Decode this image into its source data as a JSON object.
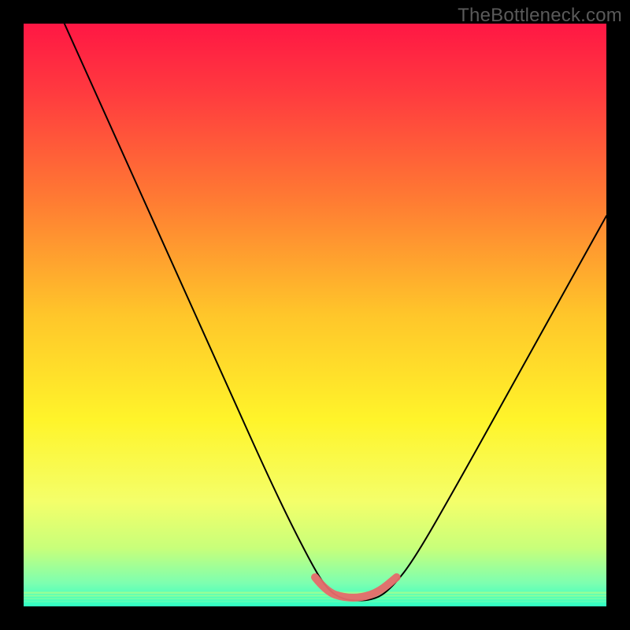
{
  "watermark": "TheBottleneck.com",
  "chart_data": {
    "type": "line",
    "title": "",
    "xlabel": "",
    "ylabel": "",
    "xlim": [
      0,
      100
    ],
    "ylim": [
      0,
      100
    ],
    "grid": false,
    "background": {
      "type": "vertical-gradient",
      "stops": [
        {
          "offset": 0.0,
          "color": "#ff1744"
        },
        {
          "offset": 0.12,
          "color": "#ff3b3f"
        },
        {
          "offset": 0.3,
          "color": "#ff7a33"
        },
        {
          "offset": 0.5,
          "color": "#ffc62a"
        },
        {
          "offset": 0.68,
          "color": "#fff42a"
        },
        {
          "offset": 0.82,
          "color": "#f4ff6a"
        },
        {
          "offset": 0.9,
          "color": "#c8ff7a"
        },
        {
          "offset": 0.96,
          "color": "#7dffb0"
        },
        {
          "offset": 1.0,
          "color": "#2affc4"
        }
      ]
    },
    "series": [
      {
        "name": "bottleneck-curve",
        "color": "#000000",
        "width": 2,
        "points": [
          {
            "x": 7,
            "y": 100
          },
          {
            "x": 16,
            "y": 80
          },
          {
            "x": 25,
            "y": 60
          },
          {
            "x": 34,
            "y": 40
          },
          {
            "x": 43,
            "y": 20
          },
          {
            "x": 49,
            "y": 8
          },
          {
            "x": 52,
            "y": 3
          },
          {
            "x": 55,
            "y": 1
          },
          {
            "x": 60,
            "y": 1
          },
          {
            "x": 63,
            "y": 3
          },
          {
            "x": 67,
            "y": 8
          },
          {
            "x": 75,
            "y": 22
          },
          {
            "x": 85,
            "y": 40
          },
          {
            "x": 95,
            "y": 58
          },
          {
            "x": 100,
            "y": 67
          }
        ]
      },
      {
        "name": "optimal-band",
        "color": "#e66a6a",
        "width": 10,
        "linecap": "round",
        "points": [
          {
            "x": 50,
            "y": 5
          },
          {
            "x": 52,
            "y": 2.5
          },
          {
            "x": 55,
            "y": 1.5
          },
          {
            "x": 58,
            "y": 1.5
          },
          {
            "x": 61,
            "y": 2.5
          },
          {
            "x": 64,
            "y": 5
          }
        ]
      }
    ],
    "bottom_bands": [
      {
        "y": 97.5,
        "color": "#b7ff84"
      },
      {
        "y": 98.0,
        "color": "#a0ff90"
      },
      {
        "y": 98.5,
        "color": "#86ffa0"
      },
      {
        "y": 99.0,
        "color": "#66ffb4"
      },
      {
        "y": 99.5,
        "color": "#3effc0"
      }
    ]
  }
}
